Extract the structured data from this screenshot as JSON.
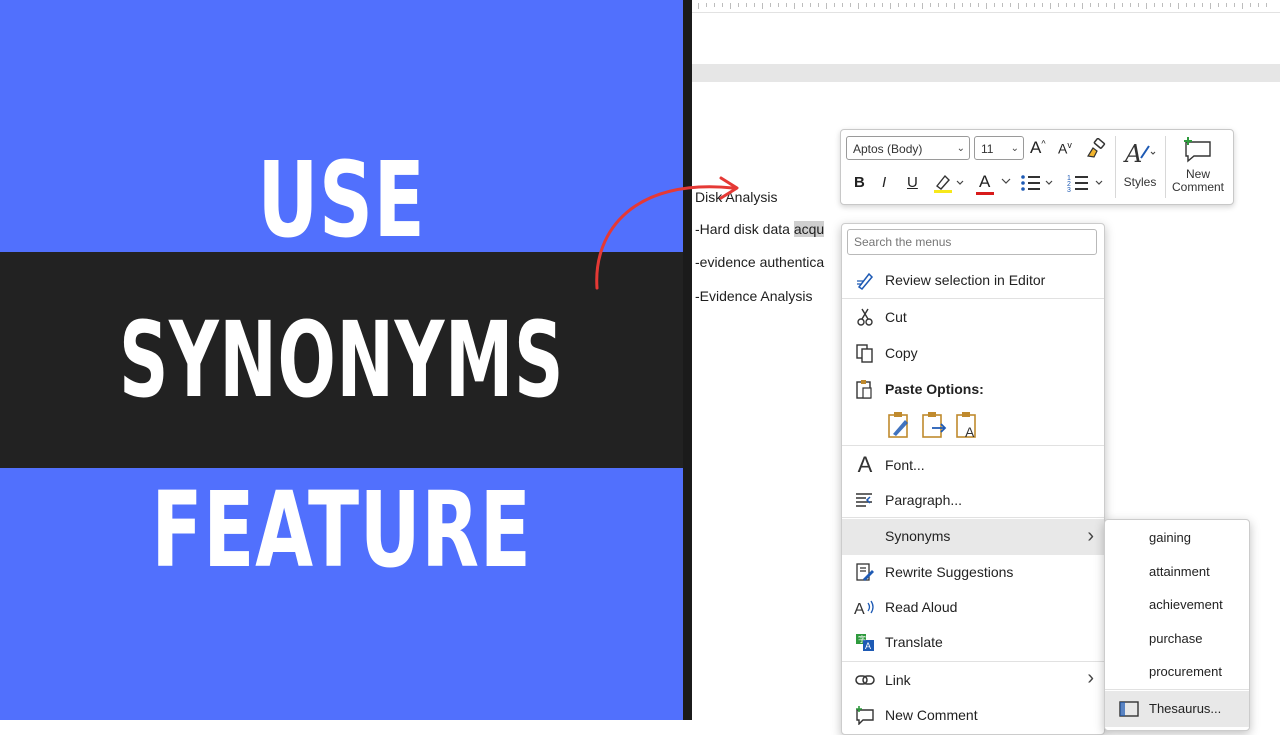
{
  "promo": {
    "line1": "USE",
    "line2": "SYNONYMS",
    "line3": "FEATURE",
    "colors": {
      "panel": "#5170fd",
      "band": "#222222",
      "text": "#ffffff",
      "arrow": "#e53935"
    }
  },
  "document": {
    "lines": [
      {
        "text": "Disk Analysis"
      },
      {
        "text_before": "-Hard disk data ",
        "selected": "acqu"
      },
      {
        "text": "-evidence authentica"
      },
      {
        "text": "-Evidence Analysis"
      }
    ]
  },
  "toolbar": {
    "font": "Aptos (Body)",
    "size": "11",
    "grow_font_label": "A",
    "shrink_font_label": "A",
    "bold": "B",
    "italic": "I",
    "underline": "U",
    "font_color_label": "A",
    "styles_label": "Styles",
    "new_comment_label": "New\nComment",
    "chev": "⌄"
  },
  "context_menu": {
    "search_placeholder": "Search the menus",
    "items": [
      {
        "label": "Review selection in Editor",
        "icon": "editor-pen-icon"
      },
      {
        "label": "Cut",
        "icon": "scissors-icon"
      },
      {
        "label": "Copy",
        "icon": "copy-icon"
      },
      {
        "label": "Paste Options:",
        "icon": "paste-icon"
      },
      {
        "label": "Font...",
        "icon": "font-icon"
      },
      {
        "label": "Paragraph...",
        "icon": "paragraph-icon"
      },
      {
        "label": "Synonyms",
        "icon": "none",
        "submenu": true
      },
      {
        "label": "Rewrite Suggestions",
        "icon": "rewrite-icon"
      },
      {
        "label": "Read Aloud",
        "icon": "read-aloud-icon"
      },
      {
        "label": "Translate",
        "icon": "translate-icon"
      },
      {
        "label": "Link",
        "icon": "link-icon",
        "submenu": true
      },
      {
        "label": "New Comment",
        "icon": "comment-icon"
      }
    ],
    "submenu_arrow": "›",
    "paste_buttons": [
      "keep-source-formatting-icon",
      "merge-formatting-icon",
      "keep-text-only-icon"
    ]
  },
  "synonyms_menu": {
    "items": [
      "gaining",
      "attainment",
      "achievement",
      "purchase",
      "procurement"
    ],
    "thesaurus_label": "Thesaurus..."
  }
}
